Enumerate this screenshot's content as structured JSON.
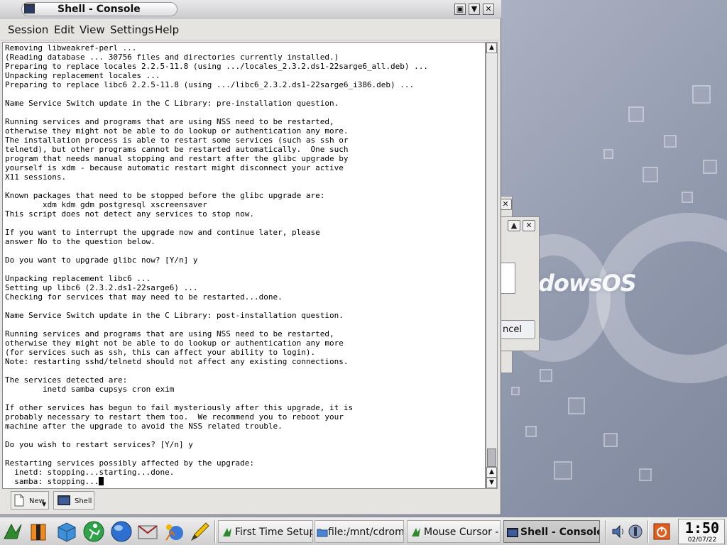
{
  "window": {
    "title": "Shell - Console",
    "controls": {
      "minimize": "▣",
      "maximize": "▼",
      "close": "✕"
    }
  },
  "menu": [
    "Session",
    "Edit",
    "View",
    "Settings",
    "Help"
  ],
  "terminal": {
    "lines": [
      "Removing libweakref-perl ...",
      "(Reading database ... 30756 files and directories currently installed.)",
      "Preparing to replace locales 2.2.5-11.8 (using .../locales_2.3.2.ds1-22sarge6_all.deb) ...",
      "Unpacking replacement locales ...",
      "Preparing to replace libc6 2.2.5-11.8 (using .../libc6_2.3.2.ds1-22sarge6_i386.deb) ...",
      "",
      "Name Service Switch update in the C Library: pre-installation question.",
      "",
      "Running services and programs that are using NSS need to be restarted,",
      "otherwise they might not be able to do lookup or authentication any more.",
      "The installation process is able to restart some services (such as ssh or",
      "telnetd), but other programs cannot be restarted automatically.  One such",
      "program that needs manual stopping and restart after the glibc upgrade by",
      "yourself is xdm - because automatic restart might disconnect your active",
      "X11 sessions.",
      "",
      "Known packages that need to be stopped before the glibc upgrade are:",
      "        xdm kdm gdm postgresql xscreensaver",
      "This script does not detect any services to stop now.",
      "",
      "If you want to interrupt the upgrade now and continue later, please",
      "answer No to the question below.",
      "",
      "Do you want to upgrade glibc now? [Y/n] y",
      "",
      "Unpacking replacement libc6 ...",
      "Setting up libc6 (2.3.2.ds1-22sarge6) ...",
      "Checking for services that may need to be restarted...done.",
      "",
      "Name Service Switch update in the C Library: post-installation question.",
      "",
      "Running services and programs that are using NSS need to be restarted,",
      "otherwise they might not be able to do lookup or authentication any more",
      "(for services such as ssh, this can affect your ability to login).",
      "Note: restarting sshd/telnetd should not affect any existing connections.",
      "",
      "The services detected are:",
      "        inetd samba cupsys cron exim",
      "",
      "If other services has begun to fail mysteriously after this upgrade, it is",
      "probably necessary to restart them too.  We recommend you to reboot your",
      "machine after the upgrade to avoid the NSS related trouble.",
      "",
      "Do you wish to restart services? [Y/n] y",
      "",
      "Restarting services possibly affected by the upgrade:",
      "  inetd: stopping...starting...done.",
      "  samba: stopping..."
    ],
    "scrollbar_position": 0.93
  },
  "sessionbar": {
    "new_label": "New",
    "shell_label": "Shell"
  },
  "background": {
    "logo_text": "dowsOS",
    "dialog_cancel_label": "ncel",
    "dialog_controls": {
      "close": "✕",
      "maximize": "▲"
    }
  },
  "taskbar": {
    "tasks": [
      {
        "label": "First Time Setup"
      },
      {
        "label": "file:/mnt/cdrom1"
      },
      {
        "label": "Mouse Cursor -"
      },
      {
        "label": "Shell - Console"
      }
    ],
    "clock": {
      "time": "1:50",
      "date": "02/07/22"
    }
  }
}
